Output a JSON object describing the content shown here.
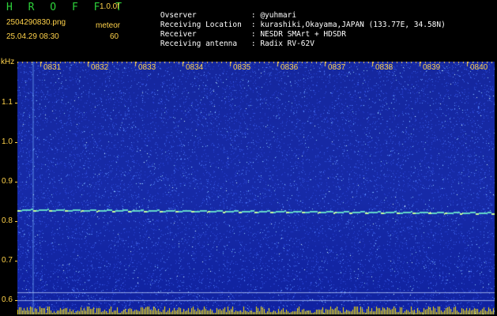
{
  "header": {
    "title": "H R O F F T",
    "version": "1.0.0f",
    "filename": "2504290830.png",
    "datetime": "25.04.29 08:30",
    "mode": "meteor",
    "count": "60"
  },
  "info": [
    {
      "label": "Ovserver",
      "value": ": @yuhmari"
    },
    {
      "label": "Receiving Location",
      "value": ": kurashiki,Okayama,JAPAN (133.77E, 34.58N)"
    },
    {
      "label": "Receiver",
      "value": ": NESDR SMArt + HDSDR"
    },
    {
      "label": "Receiving antenna",
      "value": ": Radix RV-62V"
    }
  ],
  "axis": {
    "y_unit": "kHz",
    "y_ticks": [
      "1.1",
      "1.0",
      "0.9",
      "0.8",
      "0.7",
      "0.6"
    ],
    "x_ticks": [
      "0831",
      "0832",
      "0833",
      "0834",
      "0835",
      "0836",
      "0837",
      "0838",
      "0839",
      "0840"
    ]
  },
  "colors": {
    "title": "#2dd13a",
    "labels": "#ffd24a",
    "info_text": "#ffffff",
    "background": "#0f1c80",
    "signal": "#7fffd4"
  }
}
